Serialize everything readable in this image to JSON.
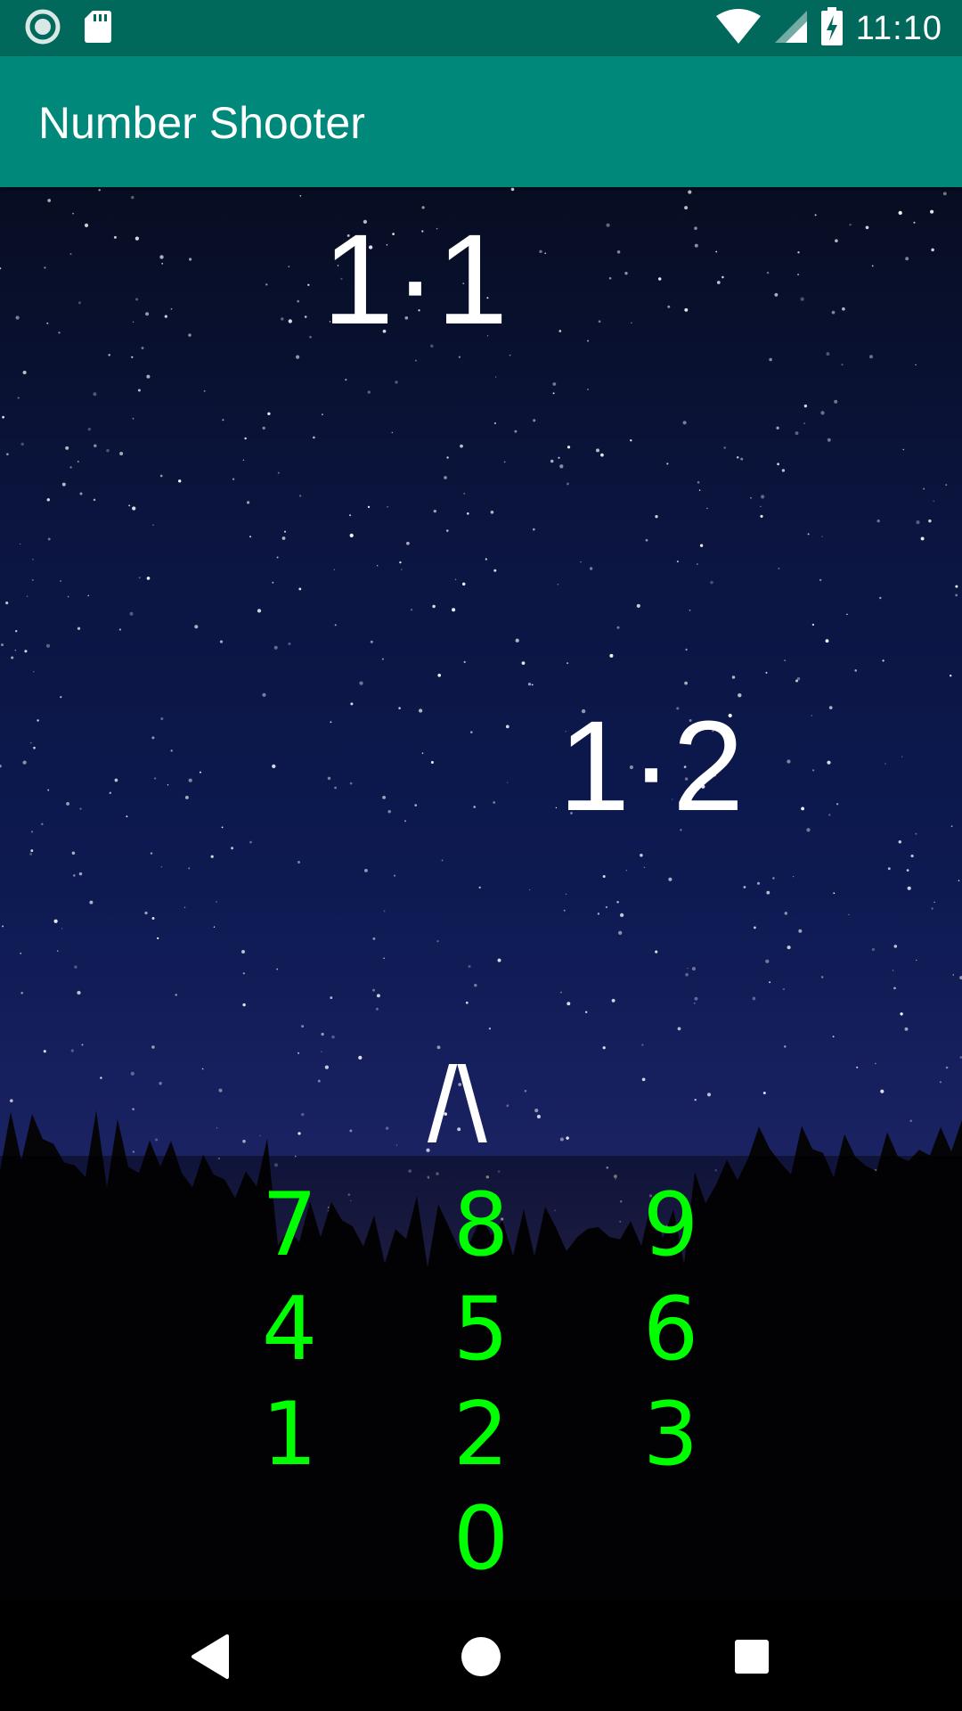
{
  "status_bar": {
    "time": "11:10",
    "icons": [
      "record-icon",
      "sd-card-icon",
      "wifi-icon",
      "signal-icon",
      "battery-charging-icon"
    ]
  },
  "app_bar": {
    "title": "Number Shooter"
  },
  "game": {
    "targets": [
      "1·1",
      "1·2"
    ],
    "shooter": "/\\"
  },
  "keypad": {
    "keys": [
      "7",
      "8",
      "9",
      "4",
      "5",
      "6",
      "1",
      "2",
      "3",
      "0"
    ],
    "color": "#00ff00"
  },
  "nav_bar": {
    "icons": [
      "back-icon",
      "home-icon",
      "recents-icon"
    ]
  },
  "colors": {
    "status_bar": "#00695c",
    "app_bar": "#00897b",
    "text": "#ffffff"
  }
}
